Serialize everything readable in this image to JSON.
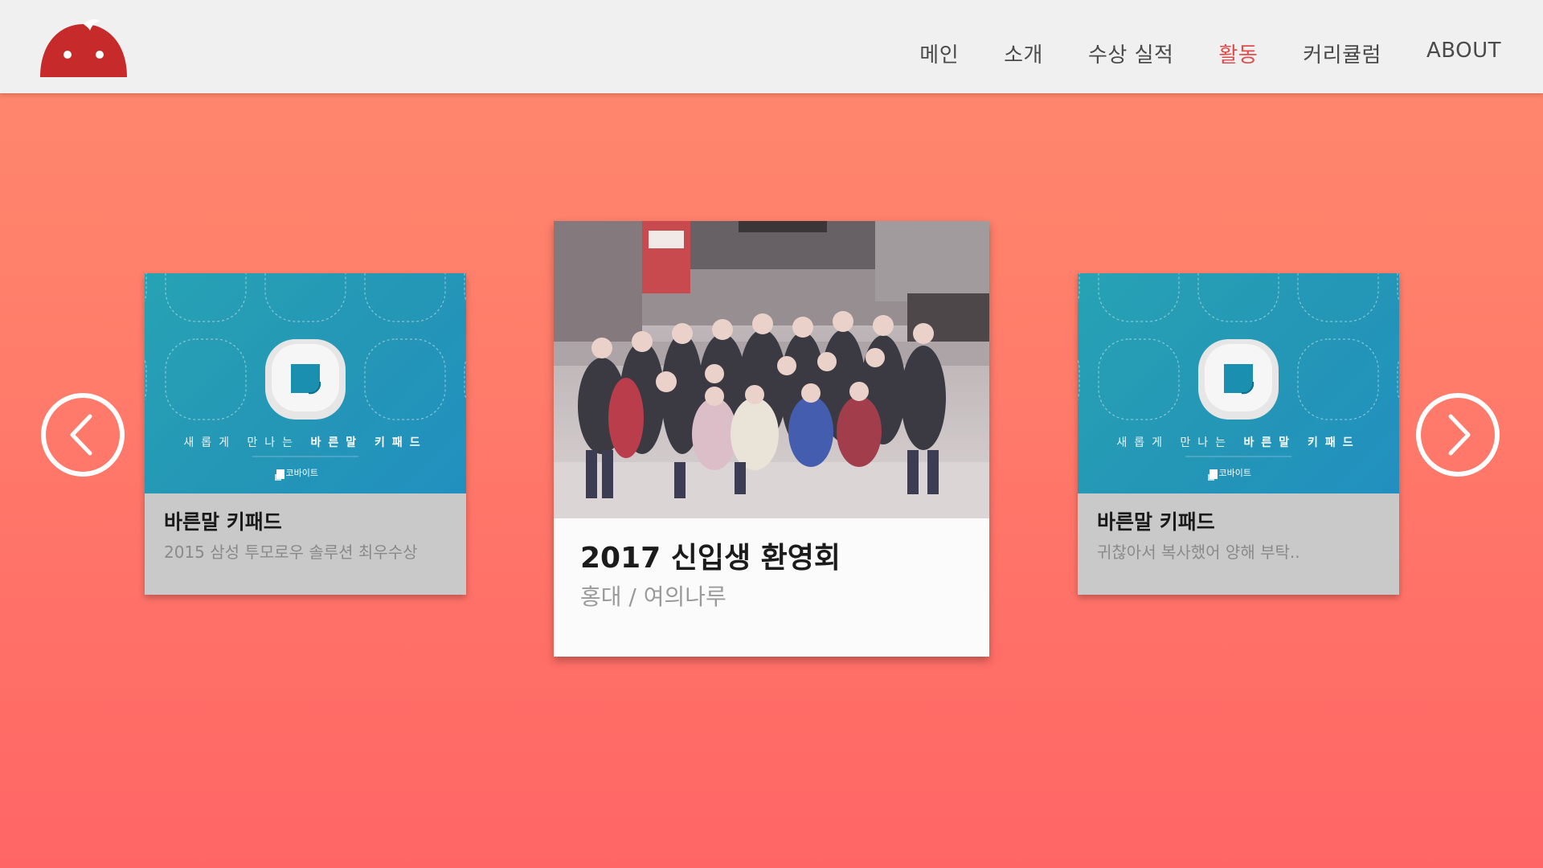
{
  "header": {
    "nav": [
      {
        "label": "메인",
        "active": false
      },
      {
        "label": "소개",
        "active": false
      },
      {
        "label": "수상 실적",
        "active": false
      },
      {
        "label": "활동",
        "active": true
      },
      {
        "label": "커리큘럼",
        "active": false
      },
      {
        "label": "ABOUT",
        "active": false
      }
    ]
  },
  "carousel": {
    "prev_icon": "chevron-left-icon",
    "next_icon": "chevron-right-icon",
    "left_card": {
      "tagline_prefix": "새롭게 만나는",
      "tagline_bold": "바른말 키패드",
      "brand": "U 코바이트",
      "title": "바른말 키패드",
      "description": "2015 삼성 투모로우 솔루션 최우수상"
    },
    "center_card": {
      "title": "2017 신입생 환영회",
      "subtitle": "홍대 / 여의나루"
    },
    "right_card": {
      "tagline_prefix": "새롭게 만나는",
      "tagline_bold": "바른말 키패드",
      "brand": "U 코바이트",
      "title": "바른말 키패드",
      "description": "귀찮아서 복사했어 양해 부탁.."
    }
  },
  "colors": {
    "accent": "#e24b4b",
    "background_top": "#ff8a6d",
    "background_bottom": "#ff6565",
    "card_teal": "#2496b6"
  }
}
